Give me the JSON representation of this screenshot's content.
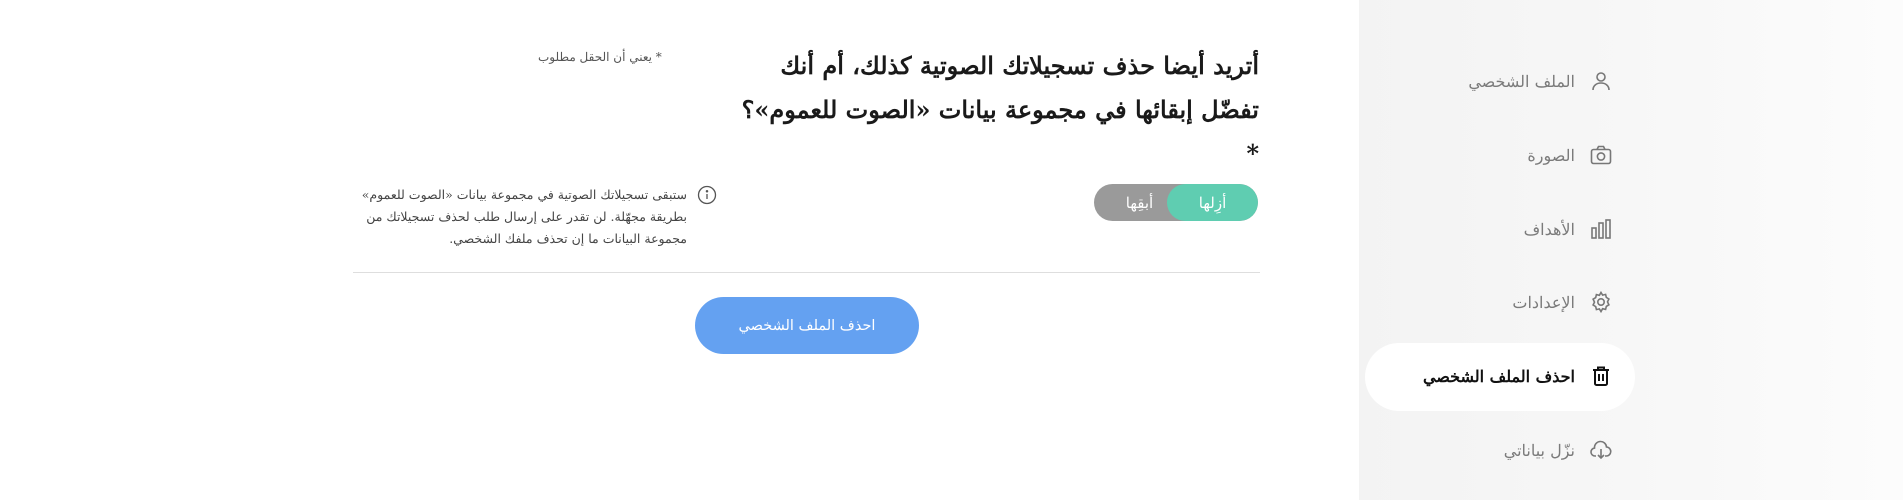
{
  "sidebar": {
    "items": [
      {
        "label": "الملف الشخصي",
        "icon": "user-icon"
      },
      {
        "label": "الصورة",
        "icon": "camera-icon"
      },
      {
        "label": "الأهداف",
        "icon": "bar-chart-icon"
      },
      {
        "label": "الإعدادات",
        "icon": "gear-icon"
      },
      {
        "label": "احذف الملف الشخصي",
        "icon": "trash-icon",
        "active": true
      },
      {
        "label": "نزّل بياناتي",
        "icon": "cloud-download-icon"
      }
    ]
  },
  "main": {
    "question": "أتريد أيضا حذف تسجيلاتك الصوتية كذلك، أم أنك تفضّل إبقائها في مجموعة بيانات «الصوت للعموم»؟*",
    "required_note": "* يعني أن الحقل مطلوب",
    "toggle": {
      "remove_label": "أزِلها",
      "keep_label": "أبقِها",
      "selected": "remove"
    },
    "info_text": "ستبقى تسجيلاتك الصوتية في مجموعة بيانات «الصوت للعموم» بطريقة مجهّلة. لن تقدر على إرسال طلب لحذف تسجيلاتك من مجموعة البيانات ما إن تحذف ملفك الشخصي.",
    "delete_button": "احذف الملف الشخصي"
  },
  "colors": {
    "accent_green": "#5fcdb1",
    "toggle_gray": "#9a9a9a",
    "button_blue": "#64a1f1",
    "sidebar_bg": "#f5f5f5"
  }
}
